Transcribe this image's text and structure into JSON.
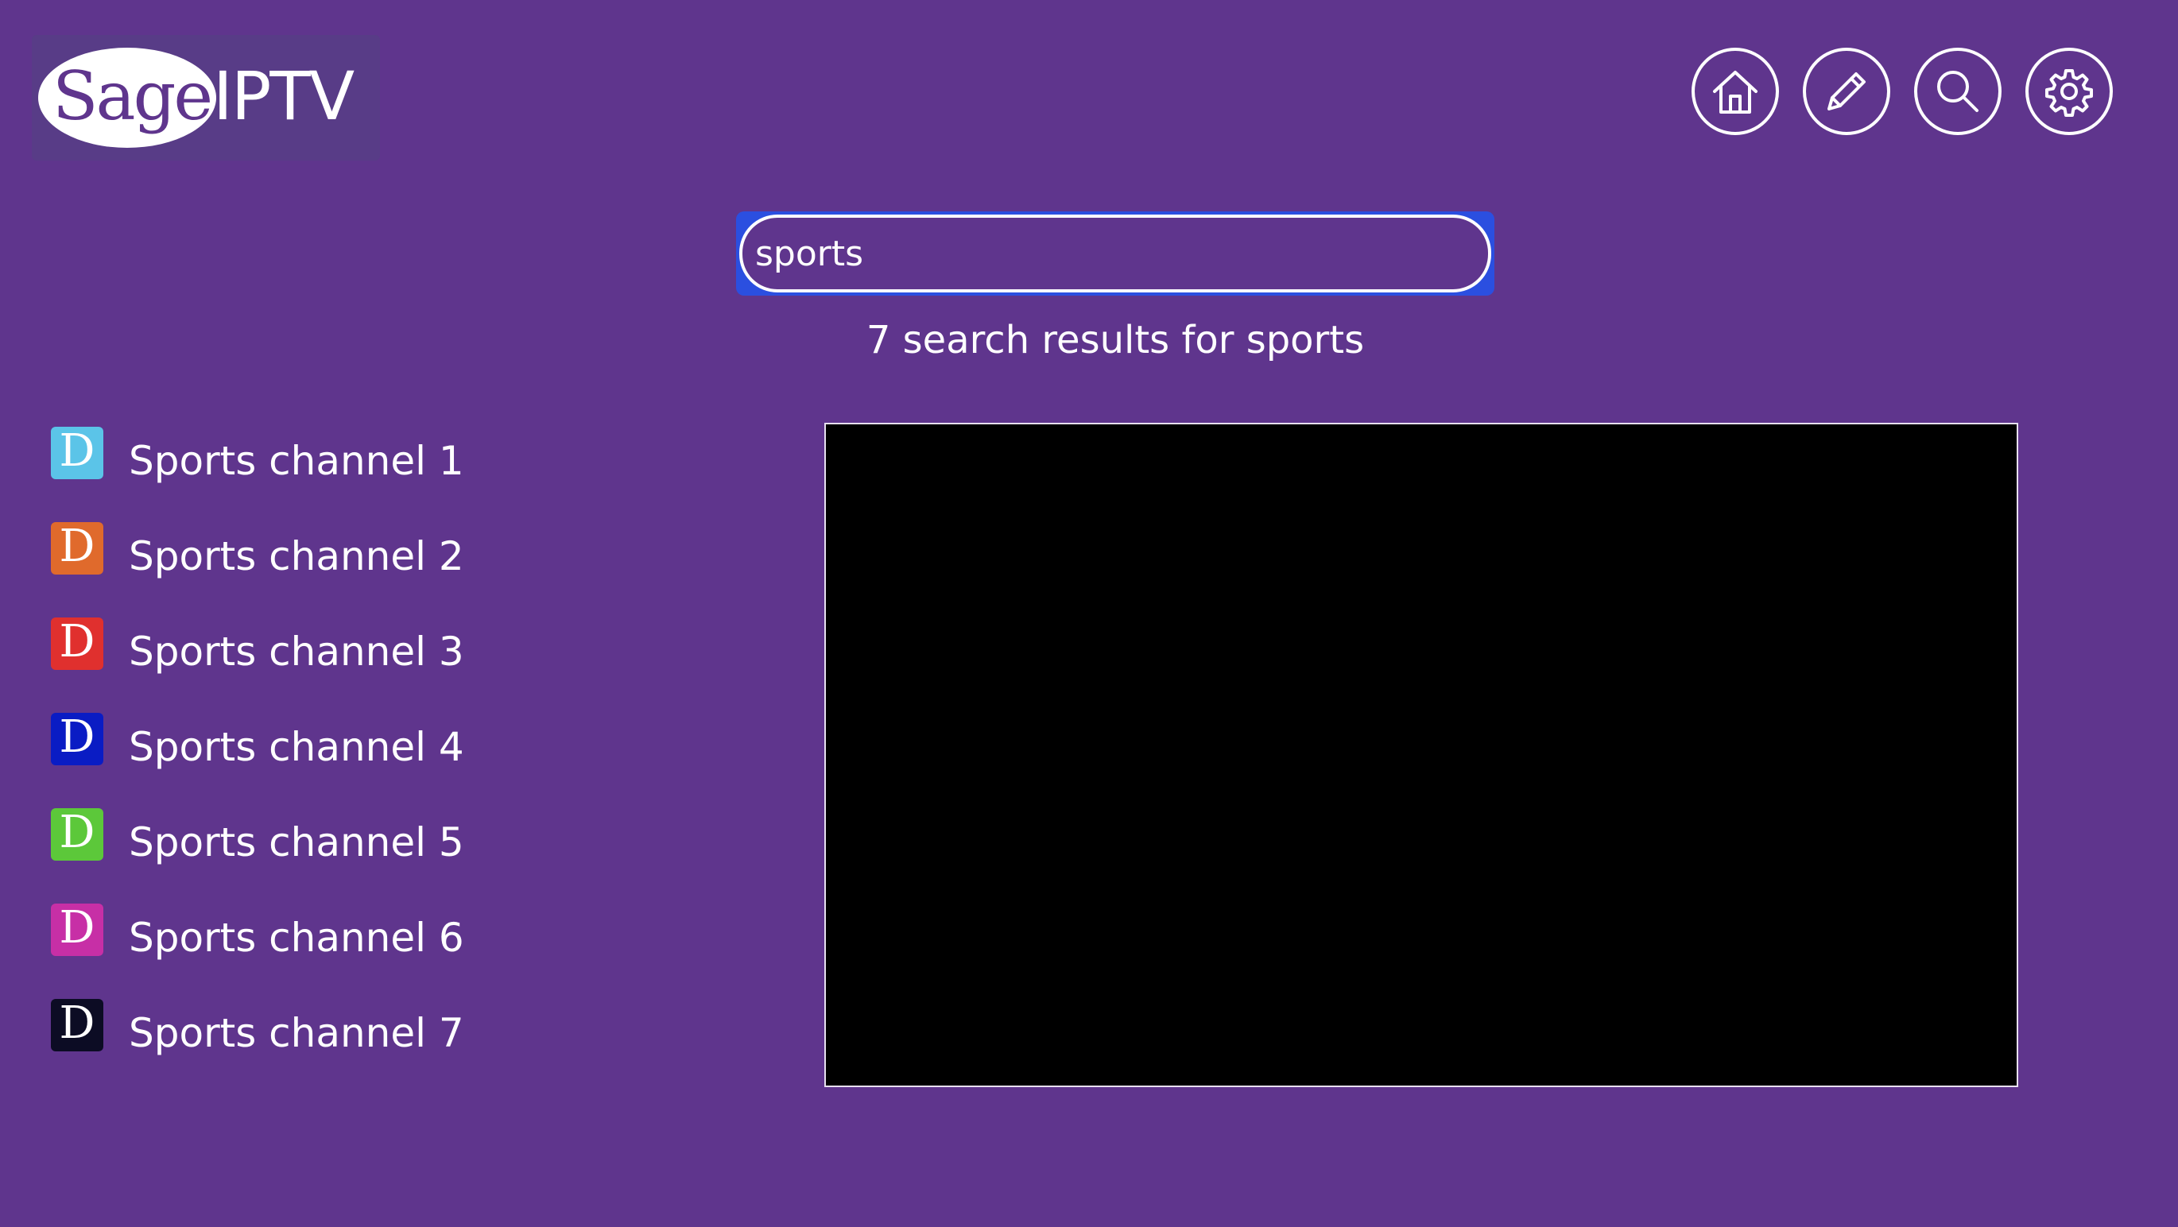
{
  "logo": {
    "sage": "Sage",
    "iptv": "IPTV"
  },
  "nav": [
    {
      "name": "home-icon",
      "label": "Home"
    },
    {
      "name": "pencil-icon",
      "label": "Edit"
    },
    {
      "name": "search-icon",
      "label": "Search"
    },
    {
      "name": "gear-icon",
      "label": "Settings"
    }
  ],
  "search": {
    "value": "sports",
    "results_text": "7 search results for sports"
  },
  "channels": [
    {
      "icon_letter": "D",
      "label": "Sports channel 1",
      "color": "#5bc4e8"
    },
    {
      "icon_letter": "D",
      "label": "Sports channel 2",
      "color": "#e06a2c"
    },
    {
      "icon_letter": "D",
      "label": "Sports channel 3",
      "color": "#e0302e"
    },
    {
      "icon_letter": "D",
      "label": "Sports channel 4",
      "color": "#0a1cc4"
    },
    {
      "icon_letter": "D",
      "label": "Sports channel 5",
      "color": "#5cc83a"
    },
    {
      "icon_letter": "D",
      "label": "Sports channel 6",
      "color": "#c72fa6"
    },
    {
      "icon_letter": "D",
      "label": "Sports channel 7",
      "color": "#0c0c24"
    }
  ],
  "colors": {
    "background": "#5f358d",
    "accent_focus": "#2b4fe0",
    "player_bg": "#000000"
  }
}
